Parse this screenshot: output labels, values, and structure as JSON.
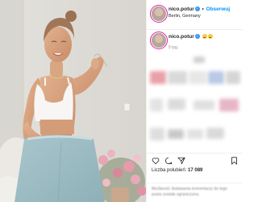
{
  "post": {
    "username": "nico.potur",
    "follow_separator": "•",
    "follow_label": "Obserwuj",
    "location": "Berlin, Germany",
    "caption_username": "nico.potur",
    "caption_emojis": [
      "emoji-1",
      "emoji-2"
    ],
    "time_ago": "5 tyg."
  },
  "actions": {
    "likes_label": "Liczba polubień:",
    "likes_count": "17 089"
  },
  "comments_notice": "Możliwość dodawania komentarzy do tego posta została ograniczona."
}
